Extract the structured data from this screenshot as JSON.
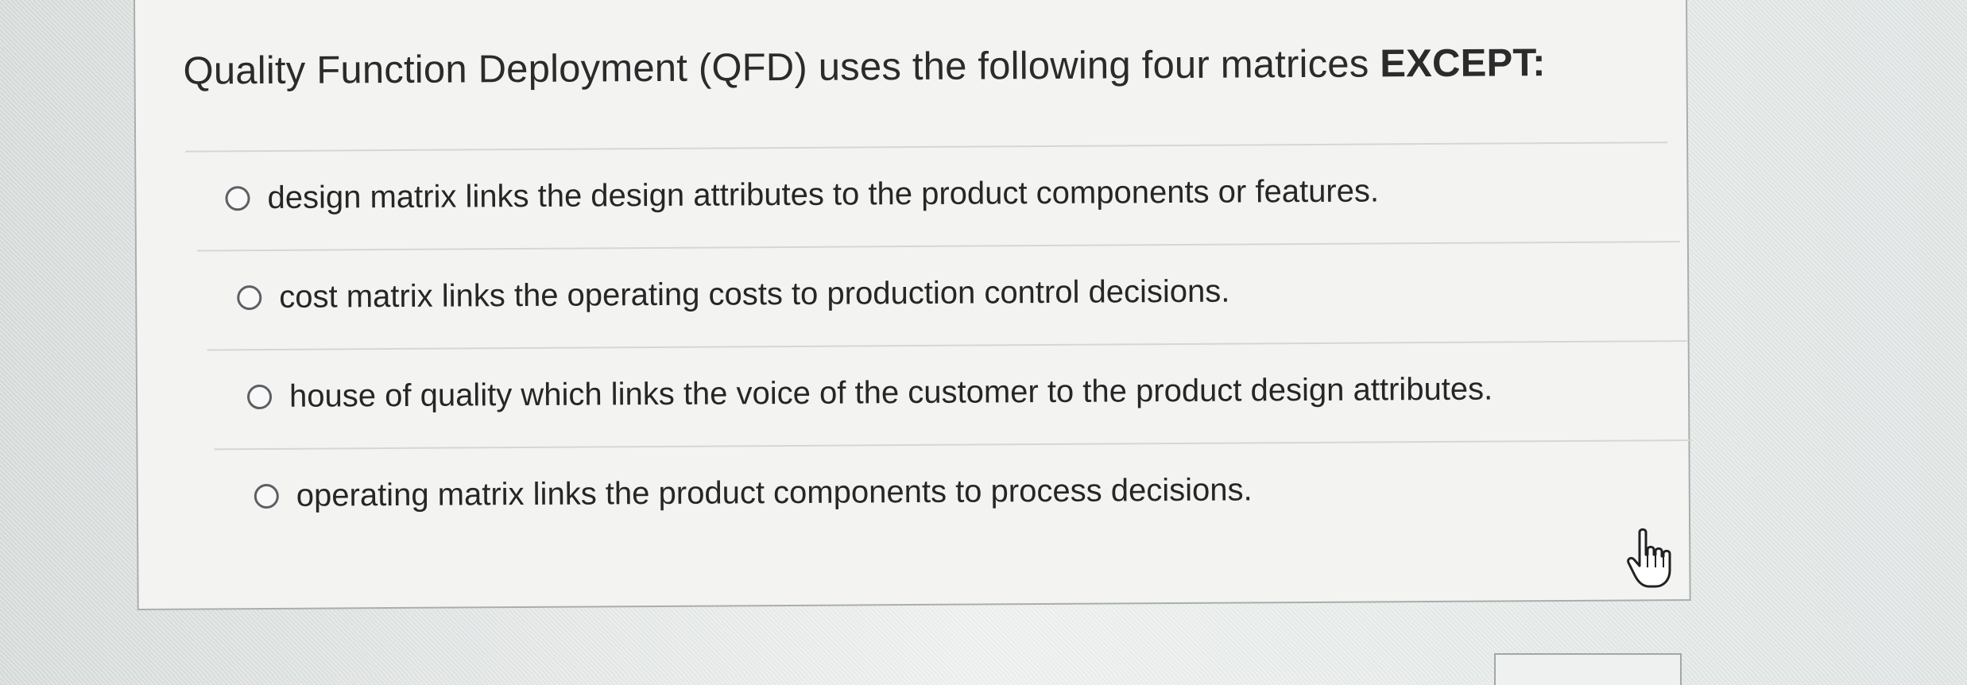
{
  "question": {
    "text": "Quality Function Deployment (QFD) uses the following four matrices",
    "emphasis": "EXCEPT:"
  },
  "options": [
    {
      "label": "design matrix links the design attributes to the product components or features.",
      "selected": false
    },
    {
      "label": "cost matrix links the operating costs to production control decisions.",
      "selected": false
    },
    {
      "label": "house of quality which links the voice of the customer to the product design attributes.",
      "selected": false
    },
    {
      "label": "operating matrix links the product components to process decisions.",
      "selected": false
    }
  ],
  "icons": {
    "radio": "radio-unselected-icon",
    "cursor": "hand-pointer-cursor-icon"
  },
  "colors": {
    "card_background": "#f3f4f2",
    "text": "#262626",
    "border": "#a9aeac"
  }
}
